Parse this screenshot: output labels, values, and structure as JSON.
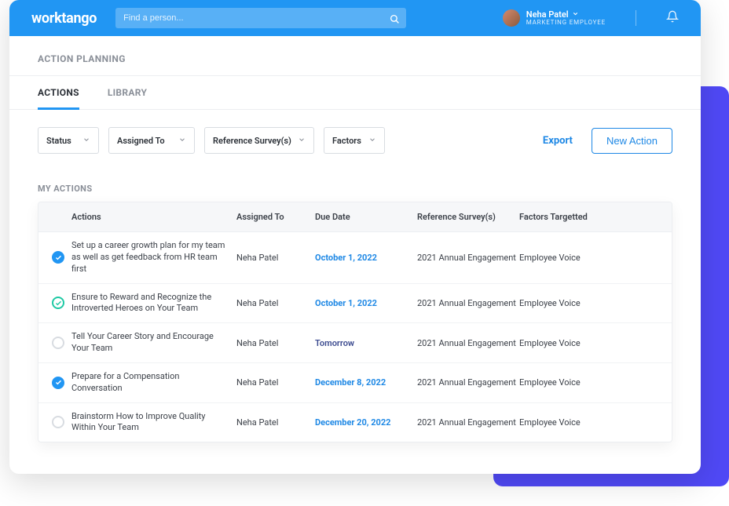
{
  "header": {
    "logo": "worktango",
    "search_placeholder": "Find a person...",
    "user": {
      "name": "Neha Patel",
      "role": "MARKETING EMPLOYEE"
    }
  },
  "page": {
    "title": "ACTION PLANNING",
    "tabs": [
      {
        "label": "ACTIONS",
        "active": true
      },
      {
        "label": "LIBRARY",
        "active": false
      }
    ],
    "filters": {
      "status": "Status",
      "assigned_to": "Assigned To",
      "reference_survey": "Reference Survey(s)",
      "factors": "Factors"
    },
    "export_label": "Export",
    "new_action_label": "New Action",
    "section_title": "MY ACTIONS",
    "columns": {
      "actions": "Actions",
      "assigned_to": "Assigned To",
      "due_date": "Due Date",
      "reference_surveys": "Reference Survey(s)",
      "factors": "Factors Targetted"
    },
    "rows": [
      {
        "status": "done",
        "action": "Set up a career growth plan for my team as well as get feedback from HR team first",
        "assigned_to": "Neha Patel",
        "due_date": "October 1, 2022",
        "due_style": "blue",
        "survey": "2021 Annual Engagement",
        "factor": "Employee Voice"
      },
      {
        "status": "progress",
        "action": "Ensure to Reward and Recognize the Introverted Heroes on Your Team",
        "assigned_to": "Neha Patel",
        "due_date": "October 1, 2022",
        "due_style": "blue",
        "survey": "2021 Annual Engagement",
        "factor": "Employee Voice"
      },
      {
        "status": "open",
        "action": "Tell Your Career Story and Encourage Your Team",
        "assigned_to": "Neha Patel",
        "due_date": "Tomorrow",
        "due_style": "navy",
        "survey": "2021 Annual Engagement",
        "factor": "Employee Voice"
      },
      {
        "status": "done",
        "action": "Prepare for a Compensation Conversation",
        "assigned_to": "Neha Patel",
        "due_date": "December 8, 2022",
        "due_style": "blue",
        "survey": "2021 Annual Engagement",
        "factor": "Employee Voice"
      },
      {
        "status": "open",
        "action": "Brainstorm How to Improve Quality Within Your Team",
        "assigned_to": "Neha Patel",
        "due_date": "December 20, 2022",
        "due_style": "blue",
        "survey": "2021 Annual Engagement",
        "factor": "Employee Voice"
      }
    ]
  }
}
